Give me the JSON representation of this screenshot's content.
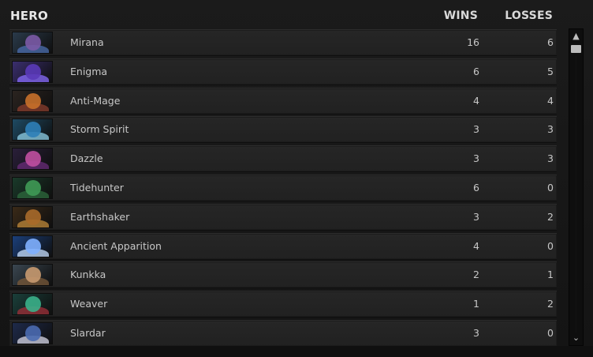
{
  "header": {
    "hero_label": "HERO",
    "wins_label": "WINS",
    "losses_label": "LOSSES"
  },
  "heroes": [
    {
      "name": "Mirana",
      "wins": "16",
      "losses": "6",
      "portrait_bg": "#2a3a4a",
      "head": "#7b5aa6",
      "glow": "#4c6fb0"
    },
    {
      "name": "Enigma",
      "wins": "6",
      "losses": "5",
      "portrait_bg": "#3a2e6e",
      "head": "#5a3ab8",
      "glow": "#8a6cff"
    },
    {
      "name": "Anti-Mage",
      "wins": "4",
      "losses": "4",
      "portrait_bg": "#2b2420",
      "head": "#c8702a",
      "glow": "#8a3d2e"
    },
    {
      "name": "Storm Spirit",
      "wins": "3",
      "losses": "3",
      "portrait_bg": "#1e4a63",
      "head": "#2d7fb8",
      "glow": "#8fd0e8"
    },
    {
      "name": "Dazzle",
      "wins": "3",
      "losses": "3",
      "portrait_bg": "#2a1f3a",
      "head": "#c04fa0",
      "glow": "#6a2c7a"
    },
    {
      "name": "Tidehunter",
      "wins": "6",
      "losses": "0",
      "portrait_bg": "#1a3a2a",
      "head": "#3f9a55",
      "glow": "#2e6b3d"
    },
    {
      "name": "Earthshaker",
      "wins": "3",
      "losses": "2",
      "portrait_bg": "#3a2a18",
      "head": "#a86a2a",
      "glow": "#c08a3a"
    },
    {
      "name": "Ancient Apparition",
      "wins": "4",
      "losses": "0",
      "portrait_bg": "#1b3f7a",
      "head": "#7fb0ff",
      "glow": "#c8e0ff"
    },
    {
      "name": "Kunkka",
      "wins": "2",
      "losses": "1",
      "portrait_bg": "#3a4650",
      "head": "#c89a70",
      "glow": "#7a5a3a"
    },
    {
      "name": "Weaver",
      "wins": "1",
      "losses": "2",
      "portrait_bg": "#1a3f3a",
      "head": "#3ab08a",
      "glow": "#a0303a"
    },
    {
      "name": "Slardar",
      "wins": "3",
      "losses": "0",
      "portrait_bg": "#1e2a4a",
      "head": "#4a6ab0",
      "glow": "#d8d8e8"
    }
  ],
  "scrollbar": {
    "up_icon": "chevron-up-icon",
    "down_icon": "chevron-down-icon",
    "up_glyph": "▲",
    "down_glyph": "⌄"
  }
}
